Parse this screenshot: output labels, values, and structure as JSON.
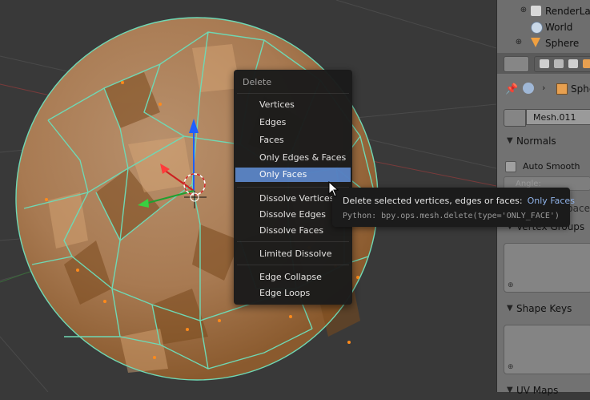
{
  "outliner": {
    "items": [
      {
        "label": "RenderLayers",
        "icon": "render-layers-icon"
      },
      {
        "label": "World",
        "icon": "world-icon"
      },
      {
        "label": "Sphere",
        "icon": "mesh-object-icon"
      }
    ]
  },
  "properties": {
    "context_label": "Spher",
    "mesh_name": "Mesh.011",
    "sections": {
      "normals": "Normals",
      "auto_smooth": "Auto Smooth",
      "angle_placeholder": "Angle:",
      "vertex_groups": "Vertex Groups",
      "shape_keys": "Shape Keys",
      "uv_maps": "UV Maps",
      "hidden_section": "...Space"
    }
  },
  "delete_menu": {
    "title": "Delete",
    "items": [
      {
        "label": "Vertices"
      },
      {
        "label": "Edges"
      },
      {
        "label": "Faces"
      },
      {
        "label": "Only Edges & Faces"
      },
      {
        "label": "Only Faces",
        "active": true
      },
      {
        "label": "Dissolve Vertices"
      },
      {
        "label": "Dissolve Edges"
      },
      {
        "label": "Dissolve Faces"
      },
      {
        "label": "Limited Dissolve"
      },
      {
        "label": "Edge Collapse"
      },
      {
        "label": "Edge Loops"
      }
    ]
  },
  "tooltip": {
    "description": "Delete selected vertices, edges or faces:",
    "value": "Only Faces",
    "python": "Python: bpy.ops.mesh.delete(type='ONLY_FACE')"
  },
  "colors": {
    "menu_highlight": "#5680c2",
    "edge_select": "#6fd8b4",
    "face_fill": "#b4825a"
  }
}
